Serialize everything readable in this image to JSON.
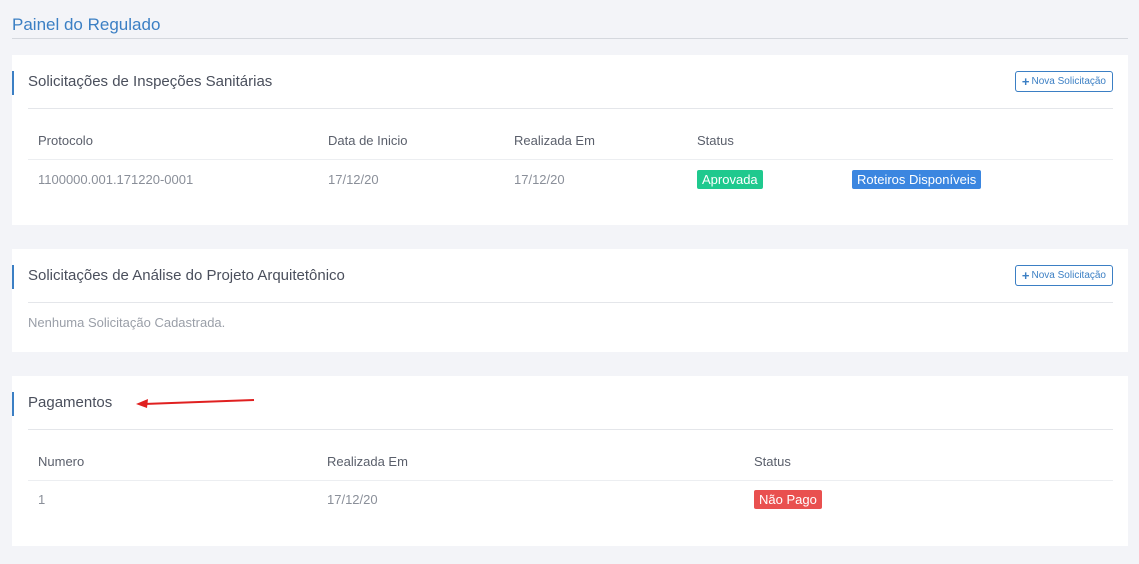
{
  "page": {
    "title": "Painel do Regulado"
  },
  "inspections": {
    "title": "Solicitações de Inspeções Sanitárias",
    "new_button_label": "Nova Solicitação",
    "columns": [
      "Protocolo",
      "Data de Inicio",
      "Realizada Em",
      "Status"
    ],
    "rows": [
      {
        "protocolo": "1100000.001.171220-0001",
        "data_inicio": "17/12/20",
        "realizada_em": "17/12/20",
        "status": "Aprovada",
        "action": "Roteiros Disponíveis"
      }
    ]
  },
  "architecture": {
    "title": "Solicitações de Análise do Projeto Arquitetônico",
    "new_button_label": "Nova Solicitação",
    "empty_message": "Nenhuma Solicitação Cadastrada."
  },
  "payments": {
    "title": "Pagamentos",
    "columns": [
      "Numero",
      "Realizada Em",
      "Status"
    ],
    "rows": [
      {
        "numero": "1",
        "realizada_em": "17/12/20",
        "status": "Não Pago"
      }
    ]
  },
  "colors": {
    "accent": "#3b7fc4",
    "approved": "#1fc98e",
    "link_badge": "#3b86e0",
    "unpaid": "#e9504f",
    "arrow": "#e02020"
  },
  "icons": {
    "plus": "plus-icon",
    "arrow": "red-arrow-annotation"
  }
}
